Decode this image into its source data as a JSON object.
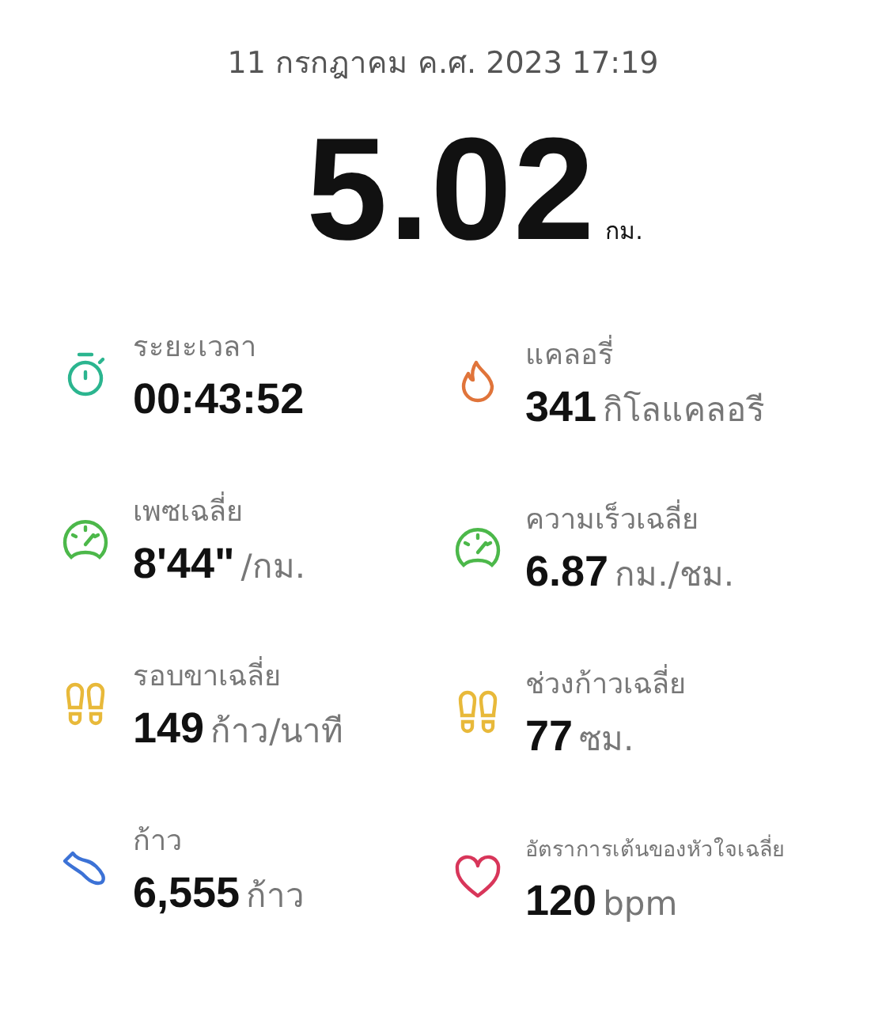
{
  "date": "11 กรกฎาคม ค.ศ. 2023 17:19",
  "distance": {
    "value": "5.02",
    "unit": "กม."
  },
  "metrics": [
    {
      "kind": "stopwatch",
      "color": "#2bb58f",
      "label": "ระยะเวลา",
      "value": "00:43:52",
      "compact": false
    },
    {
      "kind": "flame",
      "color": "#e0743a",
      "label": "แคลอรี่",
      "value": "341",
      "unit": "กิโลแคลอรี",
      "compact": false
    },
    {
      "kind": "gauge",
      "color": "#4cb84a",
      "label": "เพซเฉลี่ย",
      "value": "8'44\"",
      "unit": "/กม.",
      "compact": false
    },
    {
      "kind": "gauge",
      "color": "#4cb84a",
      "label": "ความเร็วเฉลี่ย",
      "value": "6.87",
      "unit": "กม./ชม.",
      "compact": false
    },
    {
      "kind": "footprints",
      "color": "#e8b93a",
      "label": "รอบขาเฉลี่ย",
      "value": "149",
      "unit": "ก้าว/นาที",
      "compact": false
    },
    {
      "kind": "footprints",
      "color": "#e8b93a",
      "label": "ช่วงก้าวเฉลี่ย",
      "value": "77",
      "unit": "ซม.",
      "compact": false
    },
    {
      "kind": "shoe",
      "color": "#3c72d6",
      "label": "ก้าว",
      "value": "6,555",
      "unit": "ก้าว",
      "compact": false
    },
    {
      "kind": "heart",
      "color": "#d8365a",
      "label": "อัตราการเต้นของหัวใจเฉลี่ย",
      "value": "120",
      "unit": "bpm",
      "compact": true
    }
  ]
}
